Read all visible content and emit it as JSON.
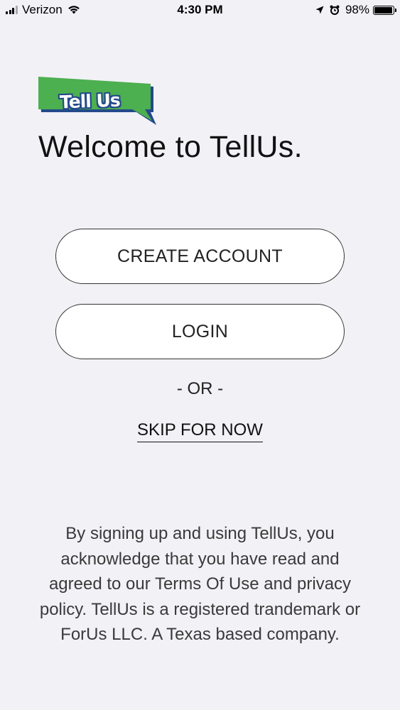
{
  "status_bar": {
    "carrier": "Verizon",
    "time": "4:30 PM",
    "battery_percent": "98%",
    "battery_level": 0.98,
    "signal_bars": 3,
    "icons": [
      "signal-icon",
      "wifi-icon",
      "location-arrow-icon",
      "alarm-icon",
      "battery-icon"
    ]
  },
  "logo": {
    "text": "Tell Us",
    "colors": {
      "green": "#4caf50",
      "navy": "#234a8a"
    }
  },
  "welcome": {
    "title": "Welcome to TellUs."
  },
  "actions": {
    "create_account_label": "CREATE ACCOUNT",
    "login_label": "LOGIN",
    "or_label": "- OR -",
    "skip_label": "SKIP FOR NOW"
  },
  "legal": {
    "disclaimer": "By signing up and using TellUs, you acknowledge that you have read and agreed to our Terms Of Use and privacy policy. TellUs is a registered trandemark or ForUs LLC. A Texas based company."
  }
}
